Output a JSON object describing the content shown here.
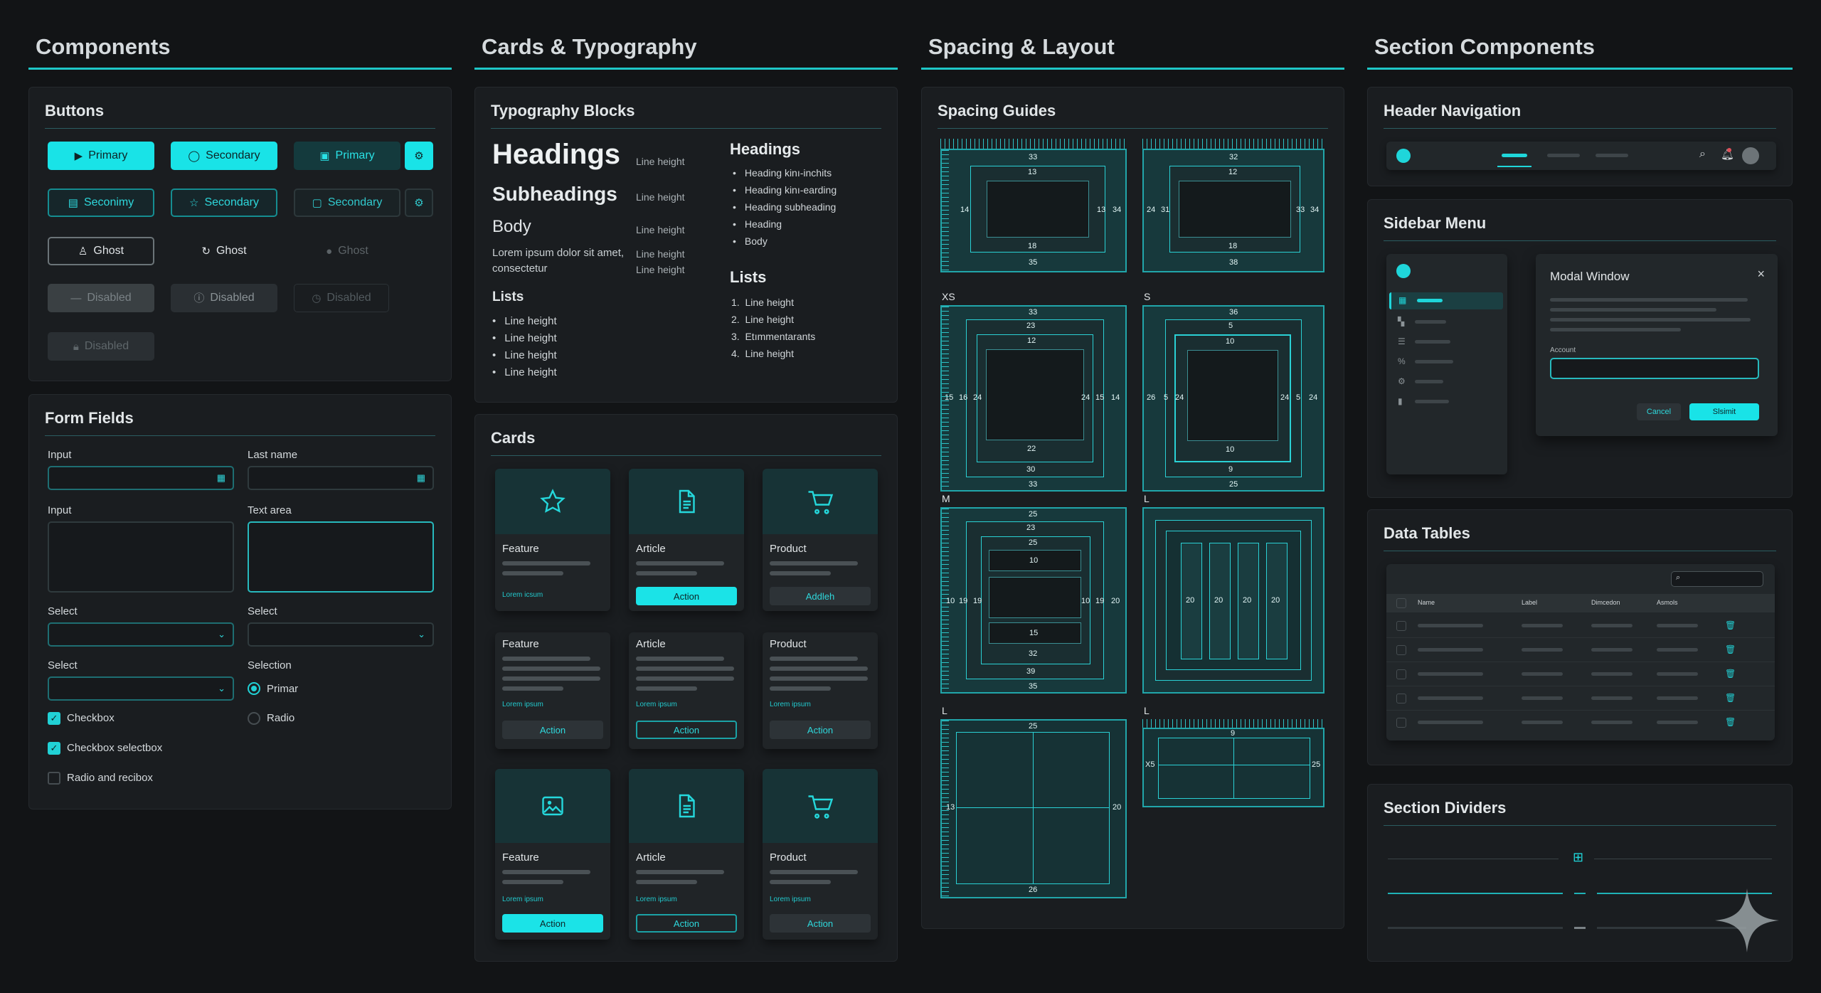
{
  "columns": {
    "components": "Components",
    "cards_typography": "Cards & Typography",
    "spacing_layout": "Spacing & Layout",
    "section_components": "Section Components"
  },
  "buttons": {
    "title": "Buttons",
    "row1": [
      "Primary",
      "Secondary",
      "Primary"
    ],
    "row2": [
      "Seconimy",
      "Secondary",
      "Secondary"
    ],
    "row3": [
      "Ghost",
      "Ghost",
      "Ghost"
    ],
    "row4": [
      "Disabled",
      "Disabled",
      "Disabled"
    ],
    "row5": "Disabled"
  },
  "form": {
    "title": "Form Fields",
    "input1_label": "Input",
    "lastname_label": "Last name",
    "input2_label": "Input",
    "textarea_label": "Text area",
    "select1_label": "Select",
    "select2_label": "Select",
    "select3_label": "Select",
    "selection_label": "Selection",
    "checkbox1": "Checkbox",
    "checkbox2": "Checkbox selectbox",
    "checkbox3": "Radio and recibox",
    "radio1": "Primar",
    "radio2": "Radio"
  },
  "typography": {
    "title": "Typography Blocks",
    "headings": "Headings",
    "subheadings": "Subheadings",
    "body": "Body",
    "body_text_1": "Lorem ipsum dolor sit amet,",
    "body_text_2": "consectetur",
    "line_height": "Line height",
    "lists": "Lists",
    "list_items": [
      "Line height",
      "Line height",
      "Line height",
      "Line height"
    ],
    "right_headings": "Headings",
    "right_bullets": [
      "Heading kinı-inchits",
      "Heading kinı-earding",
      "Heading subheading",
      "Heading",
      "Body"
    ],
    "right_lists": "Lists",
    "right_numbered": [
      "Line height",
      "Line height",
      "Etımmentarants",
      "Line height"
    ]
  },
  "cards": {
    "title": "Cards",
    "row1": [
      {
        "title": "Feature",
        "link": "Lorem icsum",
        "action": "",
        "icon": "star-icon"
      },
      {
        "title": "Article",
        "link": "",
        "action": "Action",
        "icon": "document-icon"
      },
      {
        "title": "Product",
        "link": "",
        "action": "Addleh",
        "icon": "cart-icon"
      }
    ],
    "row2": [
      {
        "title": "Feature",
        "link": "Lorem ipsum",
        "action": "Action"
      },
      {
        "title": "Article",
        "link": "Lorem ipsum",
        "action": "Action"
      },
      {
        "title": "Product",
        "link": "Lorem ipsum",
        "action": "Action"
      }
    ],
    "row3": [
      {
        "title": "Feature",
        "link": "Lorem ipsum",
        "action": "Action",
        "icon": "image-icon"
      },
      {
        "title": "Article",
        "link": "Lorem ipsum",
        "action": "Action",
        "icon": "document-icon"
      },
      {
        "title": "Product",
        "link": "Lorem ipsum",
        "action": "Action",
        "icon": "cart-icon"
      }
    ]
  },
  "spacing": {
    "title": "Spacing Guides",
    "labels": [
      "XS",
      "S",
      "M",
      "L",
      "L",
      "L"
    ],
    "box1": {
      "top": "33",
      "inner_top": "13",
      "left": "14",
      "right_a": "13",
      "right_b": "34",
      "inner_bottom": "18",
      "bottom": "35"
    },
    "box2": {
      "top": "32",
      "inner_top": "12",
      "left_a": "24",
      "left_b": "31",
      "right_a": "33",
      "right_b": "34",
      "inner_bottom": "18",
      "bottom": "38"
    },
    "box3": {
      "t1": "33",
      "t2": "23",
      "t3": "12",
      "l1": "15",
      "l2": "16",
      "l3": "24",
      "r1": "24",
      "r2": "15",
      "r3": "14",
      "b1": "22",
      "b2": "30",
      "b3": "33"
    },
    "box4": {
      "t1": "36",
      "t2": "5",
      "t3": "10",
      "l1": "26",
      "l2": "5",
      "l3": "24",
      "r1": "24",
      "r2": "5",
      "r3": "24",
      "b1": "10",
      "b2": "9",
      "b3": "25"
    },
    "box5": {
      "t1": "25",
      "t2": "23",
      "t3": "25",
      "t4": "10",
      "l1": "10",
      "l2": "19",
      "l3": "19",
      "r1": "10",
      "r2": "19",
      "r3": "20",
      "b1": "15",
      "b2": "32",
      "b3": "39",
      "b4": "35"
    },
    "box6": {
      "cols": [
        "20",
        "20",
        "20",
        "20"
      ]
    },
    "box7": {
      "top": "25",
      "left": "13",
      "right": "20",
      "bottom": "26"
    },
    "box8": {
      "top": "9",
      "left": "X5",
      "right": "25"
    }
  },
  "section": {
    "header_nav": "Header Navigation",
    "sidebar_menu": "Sidebar Menu",
    "modal_title": "Modal Window",
    "modal_field_label": "Account",
    "modal_cancel": "Cancel",
    "modal_submit": "Slsimit",
    "data_tables": "Data Tables",
    "table_headers": [
      "Name",
      "Label",
      "Dimcedon",
      "Asmols"
    ],
    "table_rows": 5,
    "section_dividers": "Section Dividers"
  },
  "colors": {
    "accent": "#1ec7c7",
    "background": "#121416",
    "panel": "#1a1d20"
  }
}
